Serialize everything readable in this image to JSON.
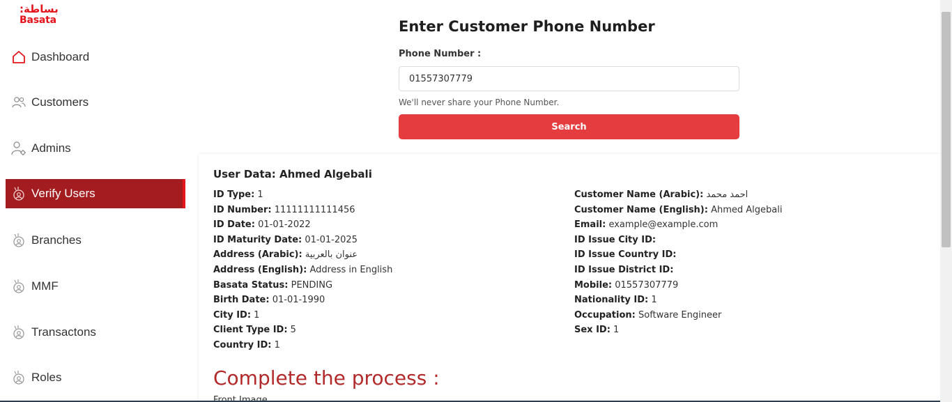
{
  "brand": {
    "logo_ar": "بساطة:",
    "logo_en": "Basata",
    "color": "#e3141b"
  },
  "sidebar": {
    "items": [
      {
        "label": "Dashboard",
        "icon": "home-icon"
      },
      {
        "label": "Customers",
        "icon": "users-icon"
      },
      {
        "label": "Admins",
        "icon": "user-gear-icon"
      },
      {
        "label": "Verify Users",
        "icon": "verify-icon",
        "active": true
      },
      {
        "label": "Branches",
        "icon": "verify-icon"
      },
      {
        "label": "MMF",
        "icon": "verify-icon"
      },
      {
        "label": "Transactons",
        "icon": "verify-icon"
      },
      {
        "label": "Roles",
        "icon": "verify-icon"
      }
    ]
  },
  "search_form": {
    "title": "Enter Customer Phone Number",
    "label": "Phone Number :",
    "value": "01557307779",
    "help": "We'll never share your Phone Number.",
    "button": "Search"
  },
  "user": {
    "title": "User Data: Ahmed Algebali",
    "left": [
      {
        "k": "ID Type:",
        "v": "1"
      },
      {
        "k": "ID Number:",
        "v": "11111111111456"
      },
      {
        "k": "ID Date:",
        "v": "01-01-2022"
      },
      {
        "k": "ID Maturity Date:",
        "v": "01-01-2025"
      },
      {
        "k": "Address (Arabic):",
        "v": "عنوان بالعربية"
      },
      {
        "k": "Address (English):",
        "v": "Address in English"
      },
      {
        "k": "Basata Status:",
        "v": "PENDING"
      },
      {
        "k": "Birth Date:",
        "v": "01-01-1990"
      },
      {
        "k": "City ID:",
        "v": "1"
      },
      {
        "k": "Client Type ID:",
        "v": "5"
      },
      {
        "k": "Country ID:",
        "v": "1"
      }
    ],
    "right": [
      {
        "k": "Customer Name (Arabic):",
        "v": "احمد محمد"
      },
      {
        "k": "Customer Name (English):",
        "v": "Ahmed Algebali"
      },
      {
        "k": "Email:",
        "v": "example@example.com"
      },
      {
        "k": "ID Issue City ID:",
        "v": ""
      },
      {
        "k": "ID Issue Country ID:",
        "v": ""
      },
      {
        "k": "ID Issue District ID:",
        "v": ""
      },
      {
        "k": "Mobile:",
        "v": "01557307779"
      },
      {
        "k": "Nationality ID:",
        "v": "1"
      },
      {
        "k": "Occupation:",
        "v": "Software Engineer"
      },
      {
        "k": "Sex ID:",
        "v": "1"
      }
    ]
  },
  "process": {
    "title": "Complete the process :",
    "front_image_label": "Front Image"
  },
  "colors": {
    "accent": "#e53d3f",
    "active_nav": "#a31c1f",
    "process_title": "#b22a2a"
  }
}
